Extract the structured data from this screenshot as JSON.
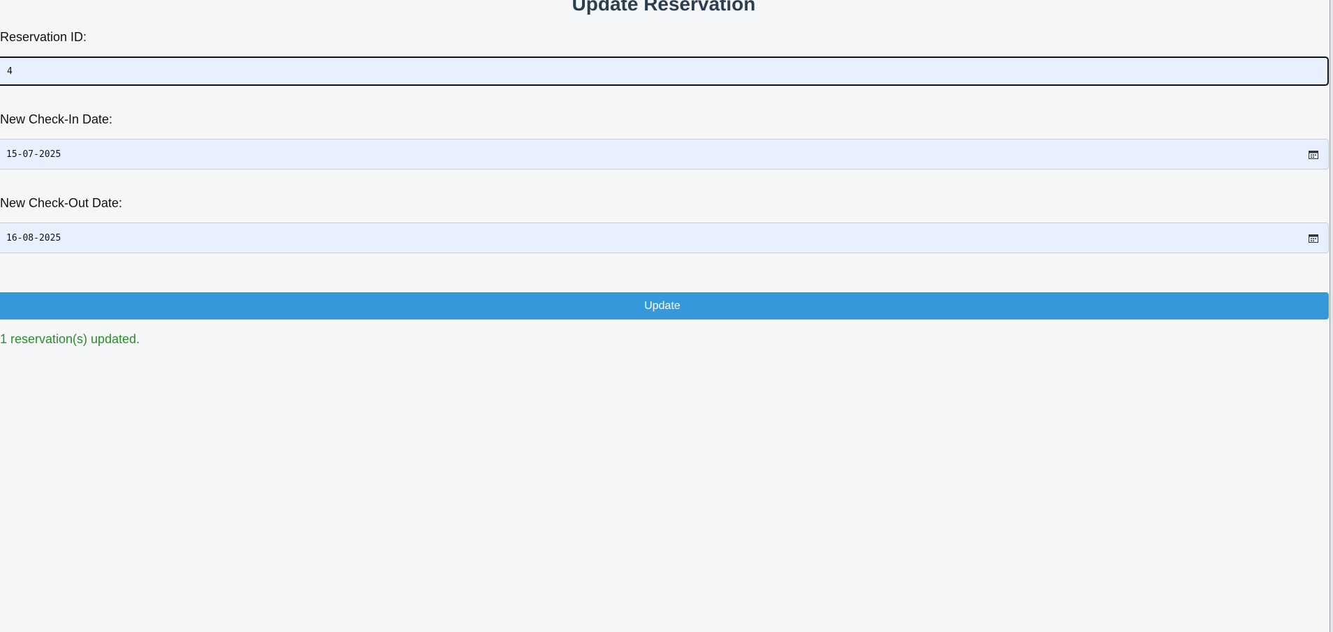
{
  "page": {
    "title": "Update Reservation"
  },
  "form": {
    "reservation_id": {
      "label": "Reservation ID:",
      "value": "4"
    },
    "check_in": {
      "label": "New Check-In Date:",
      "value": "15-07-2025",
      "icon": "calendar-icon"
    },
    "check_out": {
      "label": "New Check-Out Date:",
      "value": "16-08-2025",
      "icon": "calendar-icon"
    },
    "submit_label": "Update"
  },
  "status": {
    "message": "1 reservation(s) updated.",
    "color": "#2e8b2e"
  },
  "colors": {
    "background": "#f4f6f8",
    "title": "#2c3e50",
    "field_background": "#e8f0fe",
    "button": "#3498db"
  }
}
